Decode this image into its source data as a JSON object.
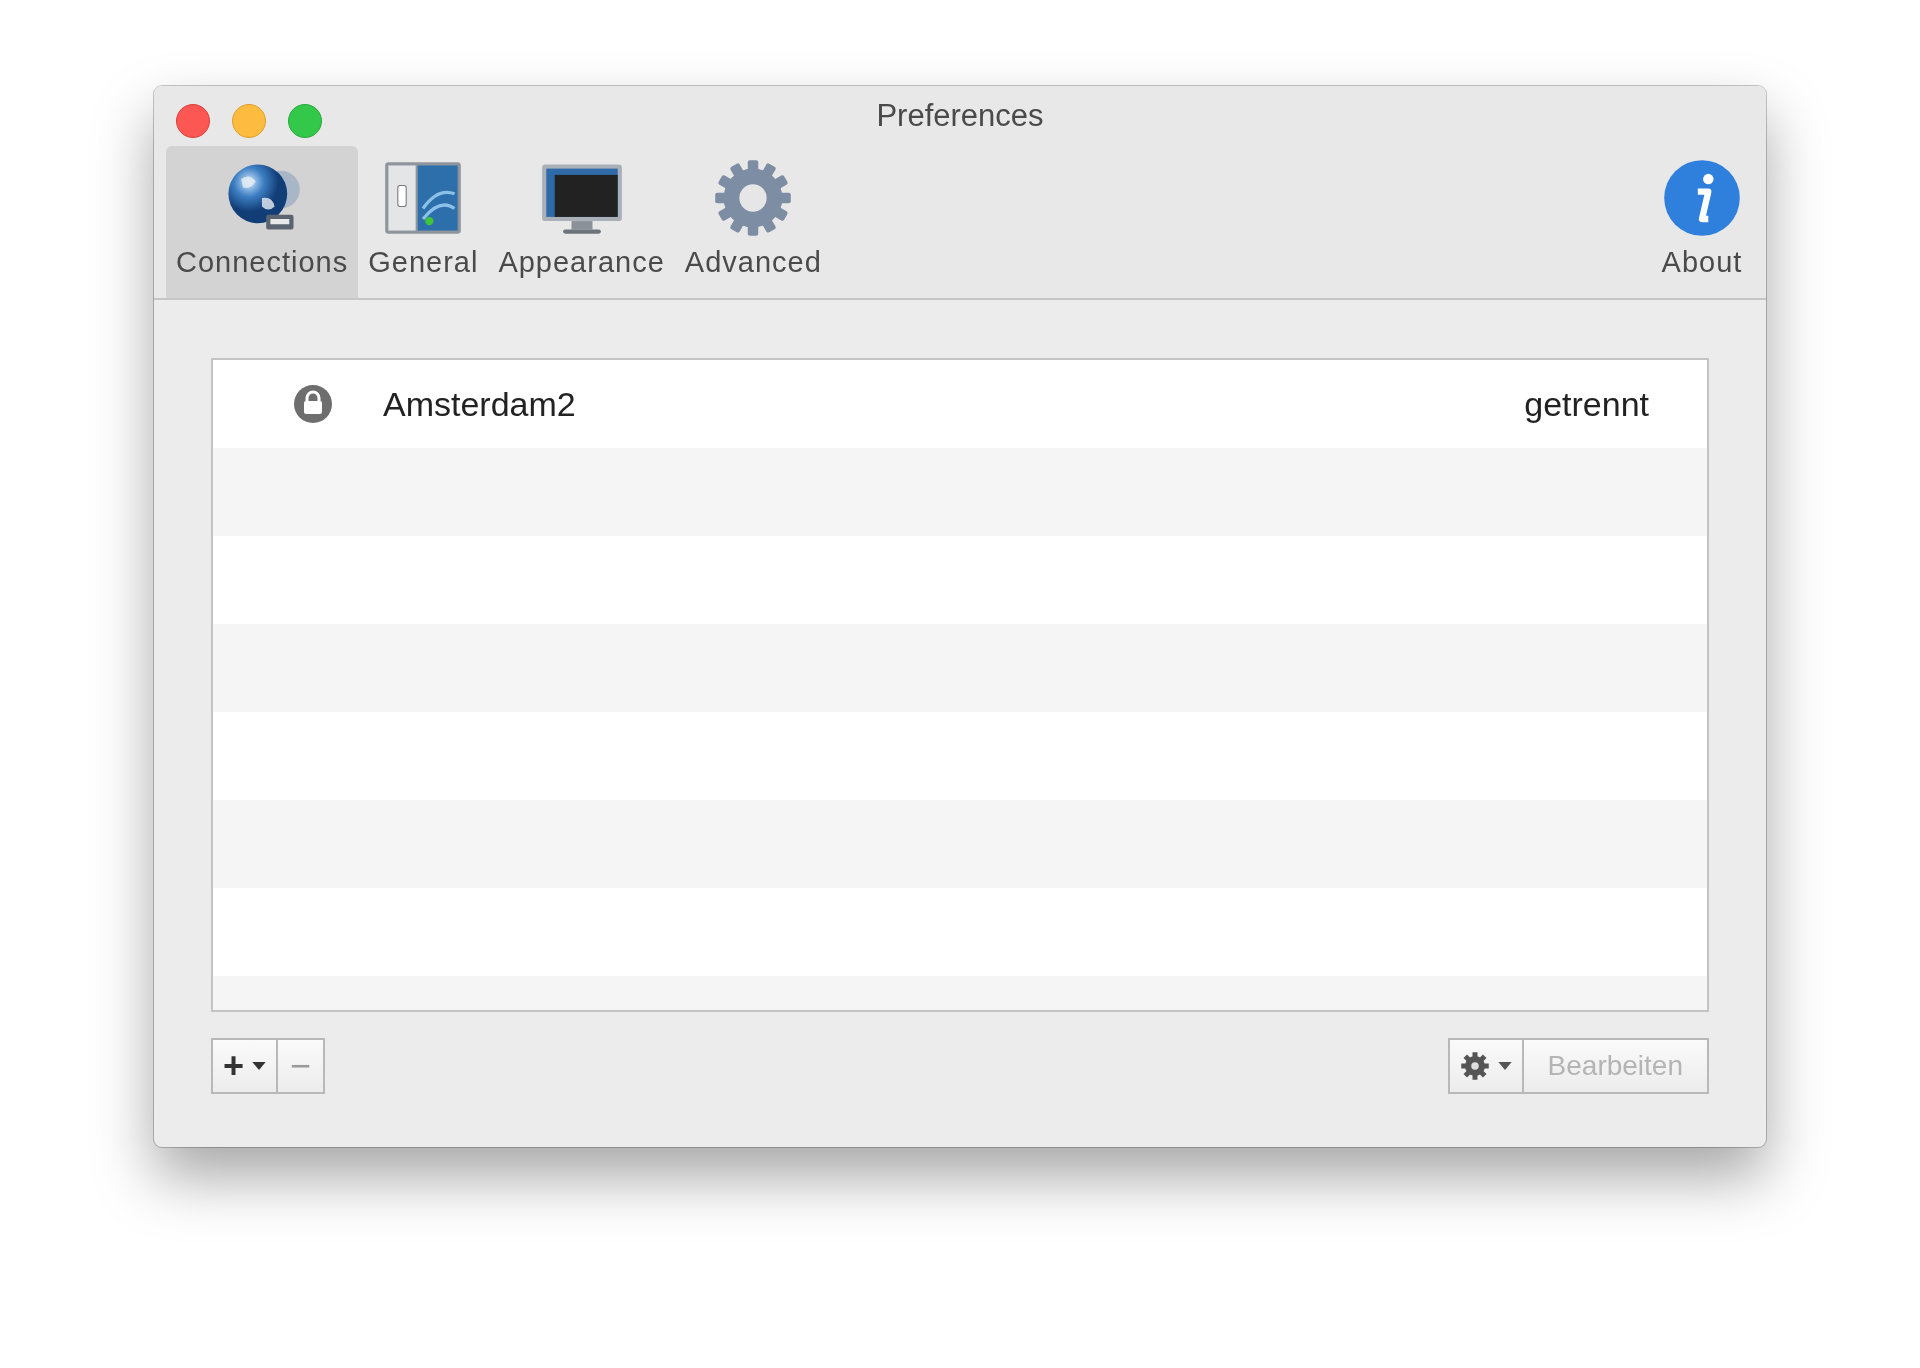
{
  "window": {
    "title": "Preferences"
  },
  "toolbar": {
    "tabs": [
      {
        "label": "Connections",
        "selected": true
      },
      {
        "label": "General",
        "selected": false
      },
      {
        "label": "Appearance",
        "selected": false
      },
      {
        "label": "Advanced",
        "selected": false
      }
    ],
    "about": {
      "label": "About"
    }
  },
  "connections": [
    {
      "name": "Amsterdam2",
      "status": "getrennt",
      "locked": true
    }
  ],
  "footer": {
    "add": "+",
    "remove": "−",
    "edit": {
      "label": "Bearbeiten",
      "disabled": true
    }
  }
}
